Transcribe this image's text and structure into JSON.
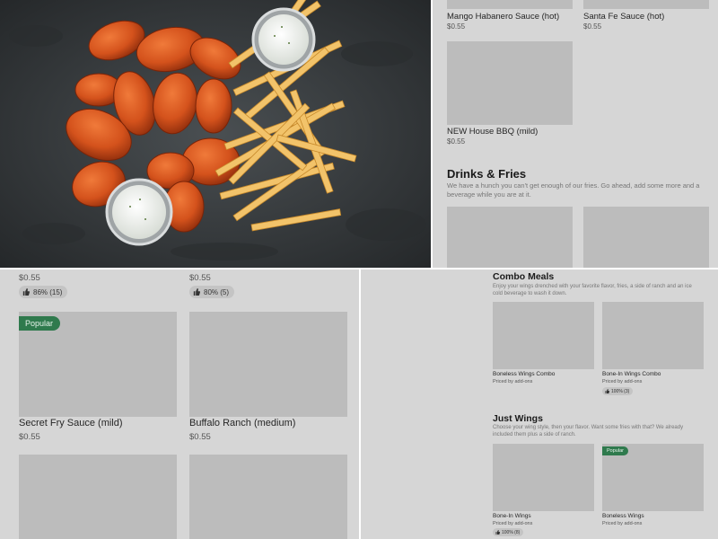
{
  "hero": {
    "image": "wings-and-fries-with-ranch-photo"
  },
  "top_right": {
    "items": [
      {
        "name": "Mango Habanero Sauce (hot)",
        "price": "$0.55"
      },
      {
        "name": "Santa Fe Sauce (hot)",
        "price": "$0.55"
      },
      {
        "name": "NEW House BBQ (mild)",
        "price": "$0.55"
      }
    ],
    "section": {
      "title": "Drinks & Fries",
      "description": "We have a hunch you can't get enough of our fries. Go ahead, add some more and a beverage while you are at it."
    }
  },
  "bottom_left": {
    "top_prices": [
      "$0.55",
      "$0.55"
    ],
    "top_ratings": [
      "86% (15)",
      "80% (5)"
    ],
    "badge": "Popular",
    "items": [
      {
        "name": "Secret Fry Sauce (mild)",
        "price": "$0.55"
      },
      {
        "name": "Buffalo Ranch (medium)",
        "price": "$0.55"
      }
    ]
  },
  "bottom_right": {
    "combo": {
      "title": "Combo Meals",
      "description": "Enjoy your wings drenched with your favorite flavor, fries, a side of ranch and an ice cold beverage to wash it down.",
      "items": [
        {
          "name": "Boneless Wings Combo",
          "price": "Priced by add-ons"
        },
        {
          "name": "Bone-In Wings Combo",
          "price": "Priced by add-ons",
          "rating": "100% (3)"
        }
      ]
    },
    "just_wings": {
      "title": "Just Wings",
      "description": "Choose your wing style, then your flavor. Want some fries with that? We already included them plus a side of ranch.",
      "badge": "Popular",
      "items": [
        {
          "name": "Bone-In Wings",
          "price": "Priced by add-ons",
          "rating": "100% (8)"
        },
        {
          "name": "Boneless Wings",
          "price": "Priced by add-ons"
        }
      ]
    }
  },
  "colors": {
    "panel_bg": "#d6d6d6",
    "placeholder": "#bcbcbc",
    "badge_green": "#2f7a4d",
    "divider": "#ffffff"
  }
}
